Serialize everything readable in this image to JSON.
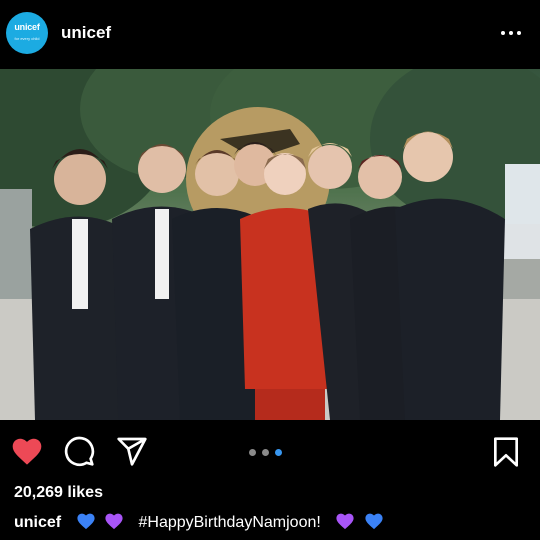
{
  "post": {
    "username": "unicef",
    "avatar": {
      "brand": "unicef",
      "tagline": "for every child",
      "color": "#1CABE2"
    },
    "more_icon": "more-horizontal-icon",
    "image_alt": "Group photo of seven young men in dark suits and a woman in a red suit making finger hearts outdoors",
    "carousel": {
      "count": 3,
      "active": 3
    },
    "actions": {
      "like_icon": "heart-filled-icon",
      "comment_icon": "comment-icon",
      "share_icon": "send-icon",
      "save_icon": "bookmark-icon",
      "like_color": "#ED4956"
    },
    "likes": "20,269 likes",
    "caption": {
      "user": "unicef",
      "text": "#HappyBirthdayNamjoon!",
      "emoji_before": [
        "blue-heart",
        "purple-heart"
      ],
      "emoji_after": [
        "purple-heart",
        "blue-heart"
      ]
    }
  },
  "colors": {
    "background": "#000000",
    "text": "#FFFFFF",
    "blue_heart": "#3B82F6",
    "purple_heart": "#A855F7"
  }
}
